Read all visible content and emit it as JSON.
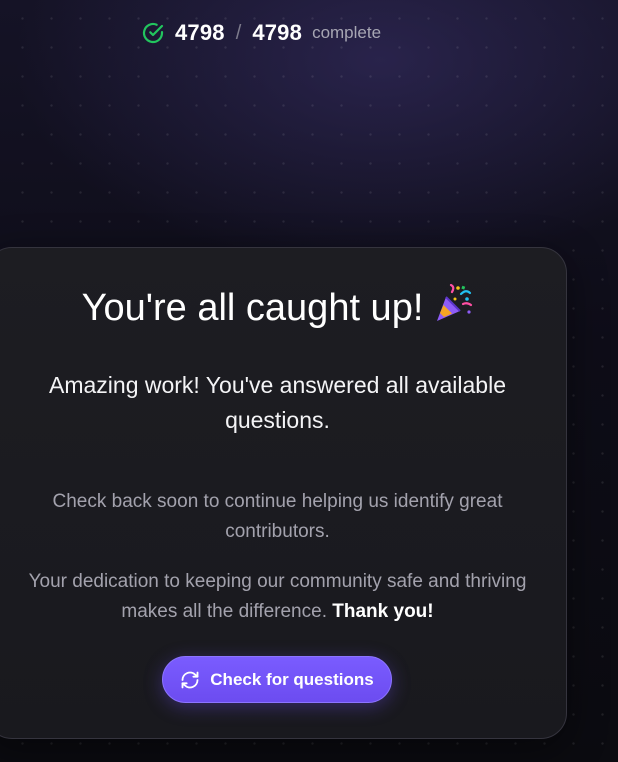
{
  "progress": {
    "answered": "4798",
    "separator": "/",
    "total": "4798",
    "label": "complete",
    "icon": "check-circle-icon",
    "icon_color": "#22c55e"
  },
  "card": {
    "title": "You're all caught up!",
    "title_icon": "party-popper-icon",
    "subtitle": "Amazing work! You've answered all available questions.",
    "body_1": "Check back soon to continue helping us identify great contributors.",
    "body_2": "Your dedication to keeping our community safe and thriving makes all the difference.",
    "thanks": "Thank you!",
    "button_label": "Check for questions",
    "button_icon": "refresh-icon",
    "accent": "#7257f8"
  }
}
